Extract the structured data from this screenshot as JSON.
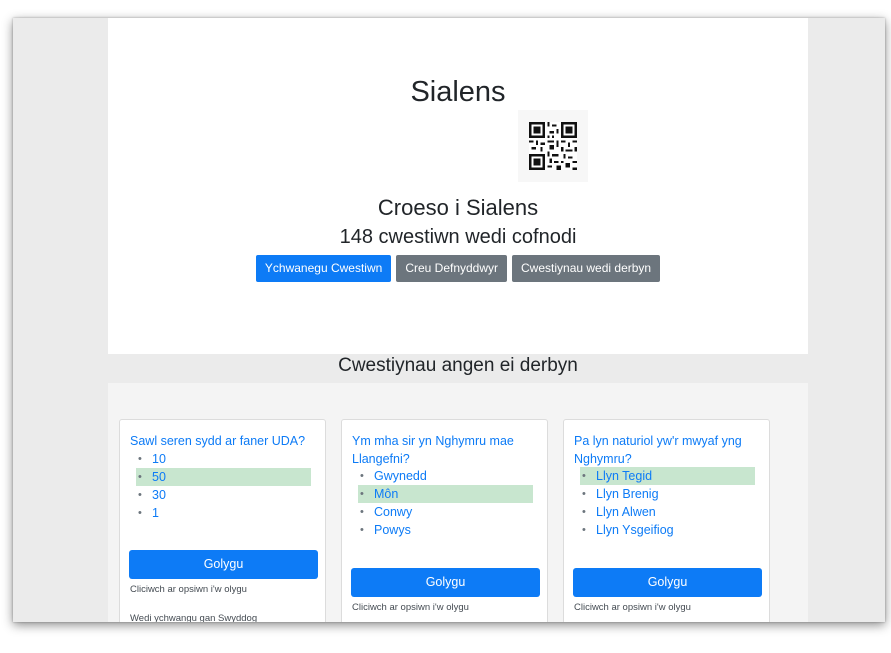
{
  "header": {
    "site_title": "Sialens",
    "welcome": "Croeso i Sialens",
    "question_count": "148 cwestiwn wedi cofnodi"
  },
  "actions": {
    "add_question": "Ychwanegu Cwestiwn",
    "create_users": "Creu Defnyddwyr",
    "accepted_questions": "Cwestiynau wedi derbyn"
  },
  "section": {
    "title": "Cwestiynau angen ei derbyn"
  },
  "cards": [
    {
      "question": "Sawl seren sydd ar faner UDA?",
      "options": [
        "10",
        "50",
        "30",
        "1"
      ],
      "correct_index": 1,
      "edit_label": "Golygu",
      "hint": "Cliciwch ar opsiwn i'w olygu",
      "added_by": "Wedi ychwangu gan Swyddog"
    },
    {
      "question": "Ym mha sir yn Nghymru mae Llangefni?",
      "options": [
        "Gwynedd",
        "Môn",
        "Conwy",
        "Powys"
      ],
      "correct_index": 1,
      "edit_label": "Golygu",
      "hint": "Cliciwch ar opsiwn i'w olygu"
    },
    {
      "question": "Pa lyn naturiol yw'r mwyaf yng Nghymru?",
      "options": [
        "Llyn Tegid",
        "Llyn Brenig",
        "Llyn Alwen",
        "Llyn Ysgeifiog"
      ],
      "correct_index": 0,
      "edit_label": "Golygu",
      "hint": "Cliciwch ar opsiwn i'w olygu"
    }
  ],
  "colors": {
    "primary": "#0d7bf6",
    "secondary": "#6c757d",
    "correct_highlight": "#c8e6cf"
  }
}
